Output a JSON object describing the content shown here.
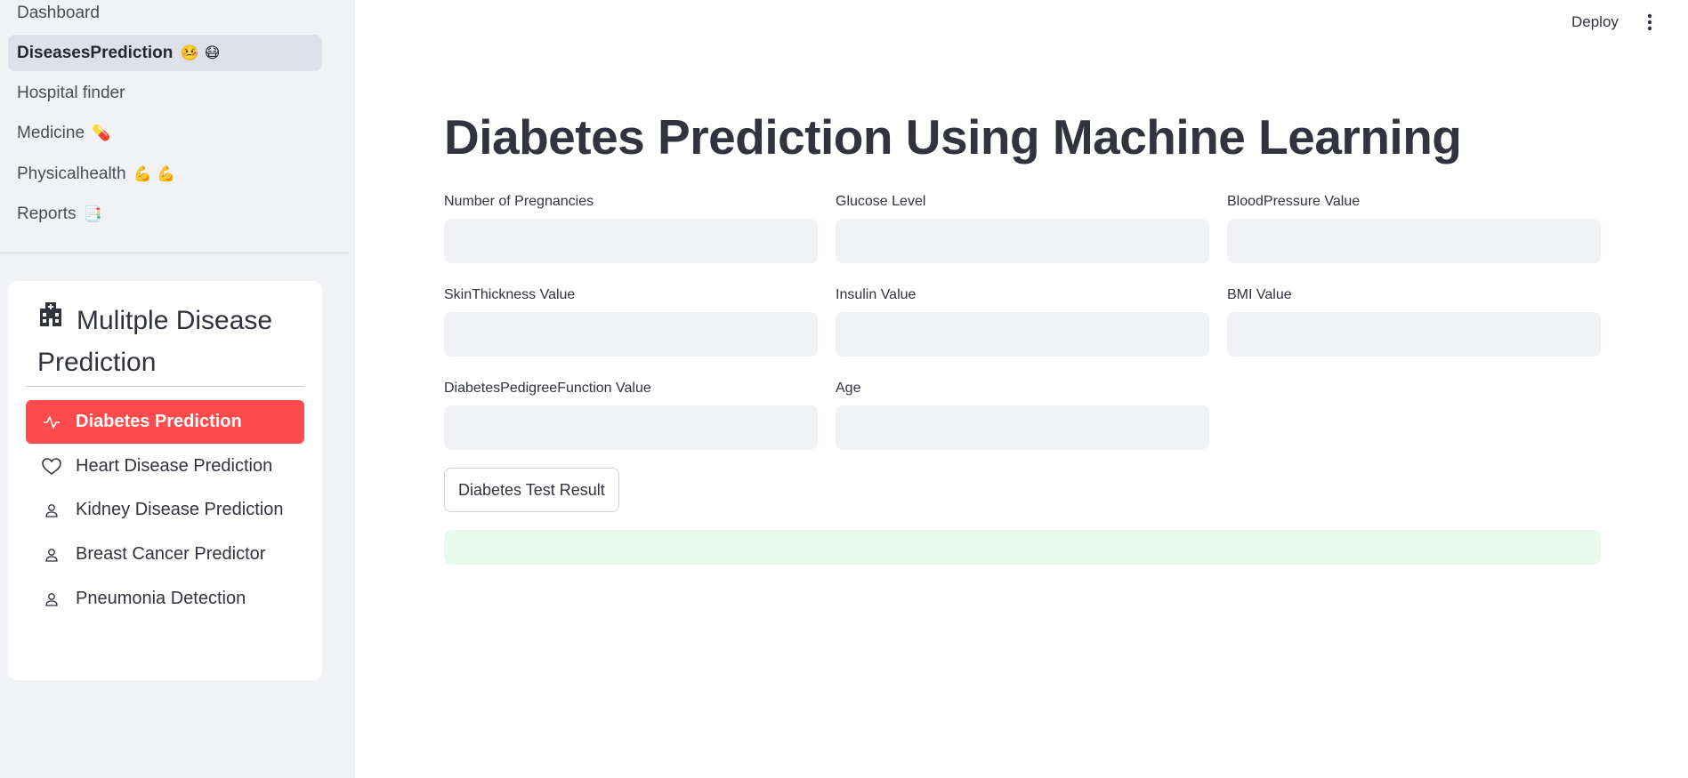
{
  "sidebar": {
    "pages": [
      {
        "label": "Dashboard",
        "emoji": ""
      },
      {
        "label": "DiseasesPrediction",
        "emoji": "🤒 😷"
      },
      {
        "label": "Hospital finder",
        "emoji": ""
      },
      {
        "label": "Medicine",
        "emoji": "💊"
      },
      {
        "label": "Physicalhealth",
        "emoji": "💪 💪"
      },
      {
        "label": "Reports",
        "emoji": "📑"
      }
    ],
    "active_page": "DiseasesPrediction",
    "menu": {
      "title": "Mulitple Disease Prediction",
      "title_icon": "hospital-icon",
      "items": [
        {
          "label": "Diabetes Prediction",
          "icon": "activity-icon"
        },
        {
          "label": "Heart Disease Prediction",
          "icon": "heart-icon"
        },
        {
          "label": "Kidney Disease Prediction",
          "icon": "person-icon"
        },
        {
          "label": "Breast Cancer Predictor",
          "icon": "person-icon"
        },
        {
          "label": "Pneumonia Detection",
          "icon": "person-icon"
        }
      ],
      "selected": "Diabetes Prediction",
      "selected_color": "#ff4b4b"
    }
  },
  "header": {
    "deploy_label": "Deploy",
    "menu_icon": "kebab-menu-icon"
  },
  "main": {
    "title": "Diabetes Prediction Using Machine Learning",
    "fields": [
      {
        "label": "Number of Pregnancies",
        "value": ""
      },
      {
        "label": "Glucose Level",
        "value": ""
      },
      {
        "label": "BloodPressure Value",
        "value": ""
      },
      {
        "label": "SkinThickness Value",
        "value": ""
      },
      {
        "label": "Insulin Value",
        "value": ""
      },
      {
        "label": "BMI Value",
        "value": ""
      },
      {
        "label": "DiabetesPedigreeFunction Value",
        "value": ""
      },
      {
        "label": "Age",
        "value": ""
      }
    ],
    "button_label": "Diabetes Test Result",
    "result_text": ""
  },
  "colors": {
    "sidebar_bg": "#f0f2f6",
    "input_bg": "#f0f2f6",
    "accent": "#ff4b4b",
    "success_bg": "#e8f9ee",
    "text": "#31333f"
  }
}
